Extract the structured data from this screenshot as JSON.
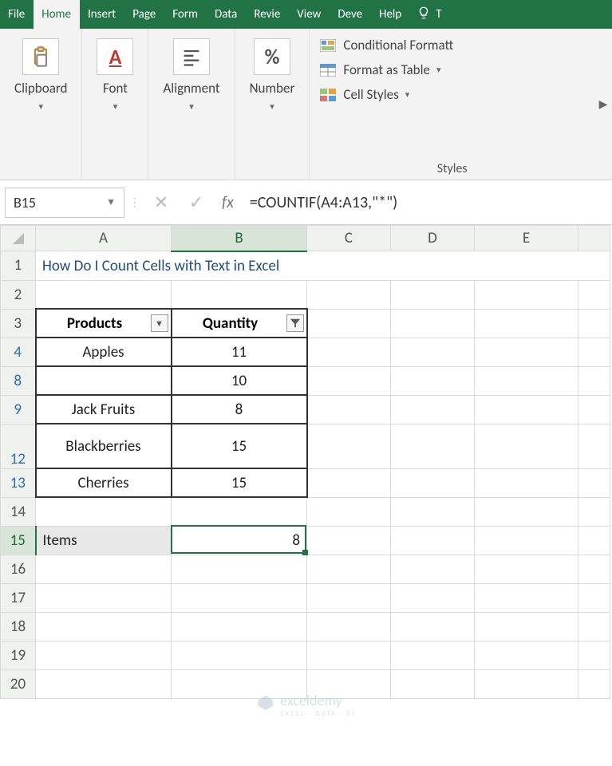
{
  "ribbon": {
    "tabs": [
      "File",
      "Home",
      "Insert",
      "Page",
      "Form",
      "Data",
      "Revie",
      "View",
      "Deve",
      "Help"
    ],
    "active_tab_index": 1,
    "tell_me_glyph": "T",
    "groups": {
      "clipboard": {
        "label": "Clipboard"
      },
      "font": {
        "label": "Font",
        "icon_text": "A"
      },
      "alignment": {
        "label": "Alignment"
      },
      "number": {
        "label": "Number",
        "icon_text": "%"
      },
      "styles": {
        "label": "Styles",
        "conditional": "Conditional Formatt",
        "table": "Format as Table",
        "cell": "Cell Styles"
      }
    }
  },
  "formula_bar": {
    "name_box": "B15",
    "fx_label": "fx",
    "formula": "=COUNTIF(A4:A13,\"*\")"
  },
  "columns": [
    "A",
    "B",
    "C",
    "D",
    "E"
  ],
  "selected_column_index": 1,
  "rows": {
    "title_row": {
      "num": "1",
      "text": "How Do I Count Cells with Text in Excel"
    },
    "blank_above": {
      "num": "2"
    },
    "header_row": {
      "num": "3",
      "products": "Products",
      "quantity": "Quantity"
    },
    "data": [
      {
        "num": "4",
        "product": "Apples",
        "qty": "11",
        "filtered": true
      },
      {
        "num": "8",
        "product": "",
        "qty": "10",
        "filtered": true
      },
      {
        "num": "9",
        "product": "Jack Fruits",
        "qty": "8",
        "filtered": true
      },
      {
        "num": "12",
        "product": "Blackberries",
        "qty": "15",
        "filtered": true,
        "tall": true
      },
      {
        "num": "13",
        "product": "Cherries",
        "qty": "15",
        "filtered": true
      }
    ],
    "gap": {
      "num": "14"
    },
    "result_row": {
      "num": "15",
      "label": "Items",
      "value": "8"
    },
    "trailing": [
      "16",
      "17",
      "18",
      "19",
      "20"
    ]
  },
  "watermark": {
    "brand": "exceldemy",
    "sub": "EXCEL · DATA · BI"
  }
}
